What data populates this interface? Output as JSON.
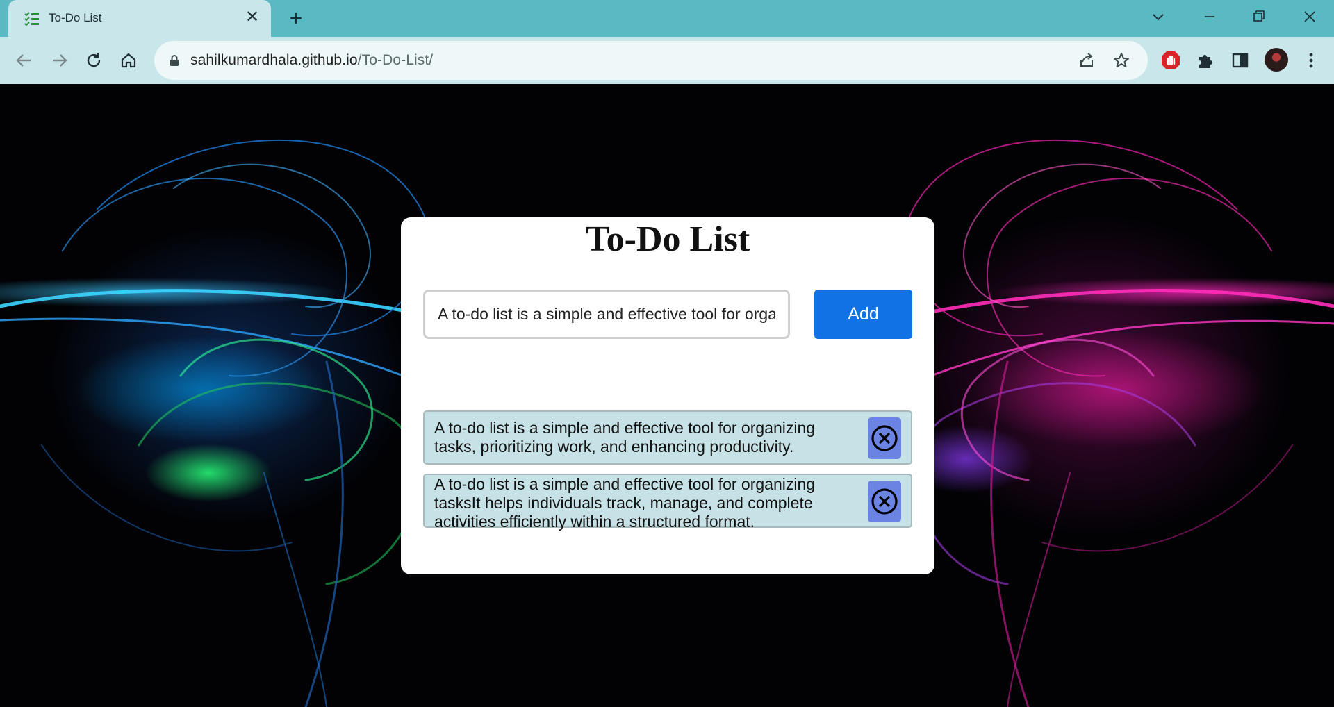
{
  "browser": {
    "tab_title": "To-Do List",
    "url_host": "sahilkumardhala.github.io",
    "url_path": "/To-Do-List/",
    "icons": [
      "tab-favicon",
      "tab-close",
      "new-tab-plus",
      "tab-search-chevron",
      "minimize",
      "restore",
      "close",
      "back-arrow",
      "forward-arrow",
      "reload",
      "home",
      "lock",
      "share",
      "bookmark-star",
      "extension-stop-sign",
      "extensions-puzzle",
      "side-panel",
      "profile-avatar",
      "more-vert"
    ]
  },
  "app": {
    "title": "To-Do List",
    "input_value": "A to-do list is a simple and effective tool for organizing tasks",
    "add_label": "Add",
    "tasks": [
      {
        "text": "A to-do list is a simple and effective tool for organizing tasks, prioritizing work, and enhancing productivity."
      },
      {
        "text": "A to-do list is a simple and effective tool for organizing tasksIt helps individuals track, manage, and complete activities efficiently within a structured format."
      }
    ]
  },
  "colors": {
    "tabstrip": "#5bb9c3",
    "toolbar": "#c9e6ea",
    "add_button": "#1172e6",
    "task_bg": "#c6e2e7",
    "delete_button": "#6b83e3"
  }
}
